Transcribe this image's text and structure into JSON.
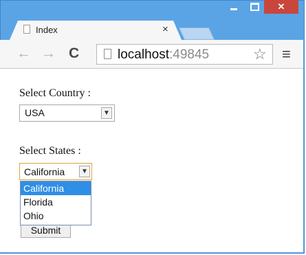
{
  "browser": {
    "tab_title": "Index",
    "tab_close": "×",
    "url_host": "localhost",
    "url_port": ":49845"
  },
  "page": {
    "country_label": "Select Country :",
    "country_value": "USA",
    "states_label": "Select States :",
    "state_value": "California",
    "state_options": [
      "California",
      "Florida",
      "Ohio"
    ],
    "submit_label": "Submit"
  },
  "icons": {
    "back": "back-arrow-icon",
    "forward": "forward-arrow-icon",
    "reload": "reload-icon",
    "star": "bookmark-star-icon",
    "menu": "menu-icon"
  },
  "colors": {
    "window_frame": "#5aa4e6",
    "close_button": "#c9463d",
    "option_highlight": "#2f8ee6",
    "focus_border": "#e3a13a"
  }
}
